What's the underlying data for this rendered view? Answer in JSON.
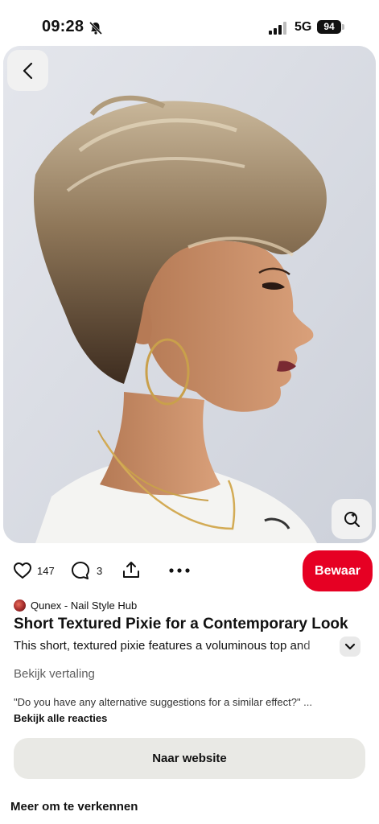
{
  "status_bar": {
    "time": "09:28",
    "network": "5G",
    "battery": "94"
  },
  "pin": {
    "image_icons": {
      "back": "chevron-left-icon",
      "visual_search": "lens-search-icon"
    },
    "actions": {
      "like_count": "147",
      "comment_count": "3",
      "save_label": "Bewaar"
    },
    "creator_name": "Qunex - Nail Style Hub",
    "title": "Short Textured Pixie for a Contemporary Look",
    "description": "This short, textured pixie features a voluminous top and",
    "translate_label": "Bekijk vertaling",
    "comment_preview": "\"Do you have any alternative suggestions for a similar effect?\" ...",
    "all_comments_label": "Bekijk alle reacties",
    "website_button_label": "Naar website",
    "explore_heading": "Meer om te verkennen"
  },
  "colors": {
    "accent_red": "#e60023",
    "button_gray": "#e9e9e5"
  }
}
